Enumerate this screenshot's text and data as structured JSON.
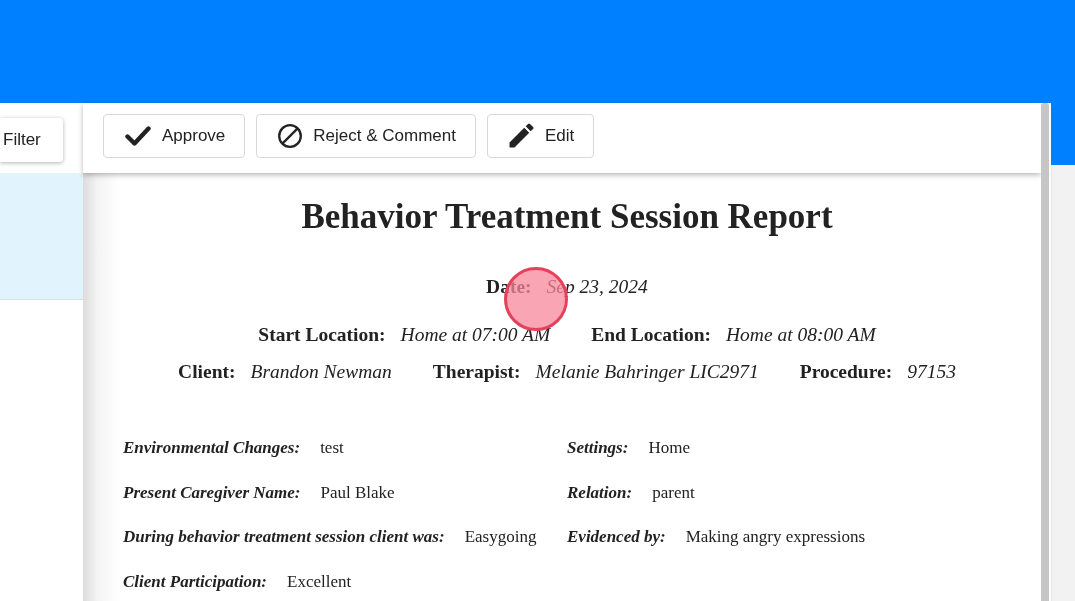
{
  "side_panel": {
    "filter_button": "Filter"
  },
  "toolbar": {
    "buttons": [
      {
        "kind": "approve",
        "label": "Approve"
      },
      {
        "kind": "reject",
        "label": "Reject & Comment"
      },
      {
        "kind": "edit",
        "label": "Edit"
      }
    ]
  },
  "report": {
    "title": "Behavior Treatment Session Report",
    "header_rows": [
      [
        {
          "label": "Date:",
          "value": "Sep 23, 2024"
        }
      ],
      [
        {
          "label": "Start Location:",
          "value": "Home at 07:00 AM"
        },
        {
          "label": "End Location:",
          "value": "Home at 08:00 AM"
        }
      ],
      [
        {
          "label": "Client:",
          "value": "Brandon Newman"
        },
        {
          "label": "Therapist:",
          "value": "Melanie Bahringer LIC2971"
        },
        {
          "label": "Procedure:",
          "value": "97153"
        }
      ]
    ],
    "fields": [
      {
        "label": "Environmental Changes:",
        "value": "test"
      },
      {
        "label": "Settings:",
        "value": "Home"
      },
      {
        "label": "Present Caregiver Name:",
        "value": "Paul Blake"
      },
      {
        "label": "Relation:",
        "value": "parent"
      },
      {
        "label": "During behavior treatment session client was:",
        "value": "Easygoing"
      },
      {
        "label": "Evidenced by:",
        "value": "Making angry expressions"
      },
      {
        "label": "Client Participation:",
        "value": "Excellent"
      }
    ]
  }
}
